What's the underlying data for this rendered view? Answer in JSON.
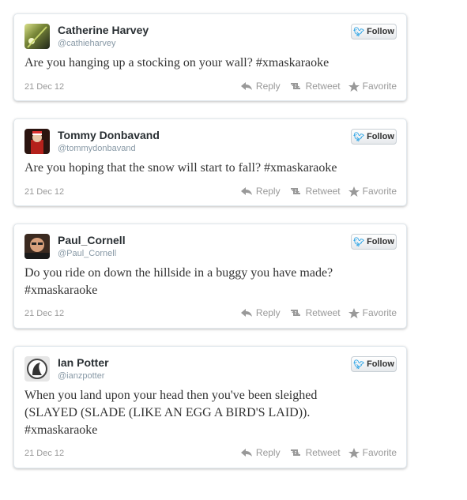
{
  "follow_label": "Follow",
  "actions": {
    "reply": "Reply",
    "retweet": "Retweet",
    "favorite": "Favorite"
  },
  "tweets": [
    {
      "name": "Catherine Harvey",
      "handle": "@cathieharvey",
      "lines": [
        "Are you hanging up a stocking on your wall? #xmaskaraoke"
      ],
      "date": "21 Dec 12"
    },
    {
      "name": "Tommy Donbavand",
      "handle": "@tommydonbavand",
      "lines": [
        "Are you hoping that the snow will start to fall? #xmaskaraoke"
      ],
      "date": "21 Dec 12"
    },
    {
      "name": "Paul_Cornell",
      "handle": "@Paul_Cornell",
      "lines": [
        "Do you ride on down the hillside in a buggy you have made?",
        "#xmaskaraoke"
      ],
      "date": "21 Dec 12"
    },
    {
      "name": "Ian Potter",
      "handle": "@ianzpotter",
      "lines": [
        "When you land upon your head then you've been sleighed",
        "(SLAYED (SLADE (LIKE AN EGG A BIRD'S LAID)).",
        "#xmaskaraoke"
      ],
      "date": "21 Dec 12"
    }
  ]
}
